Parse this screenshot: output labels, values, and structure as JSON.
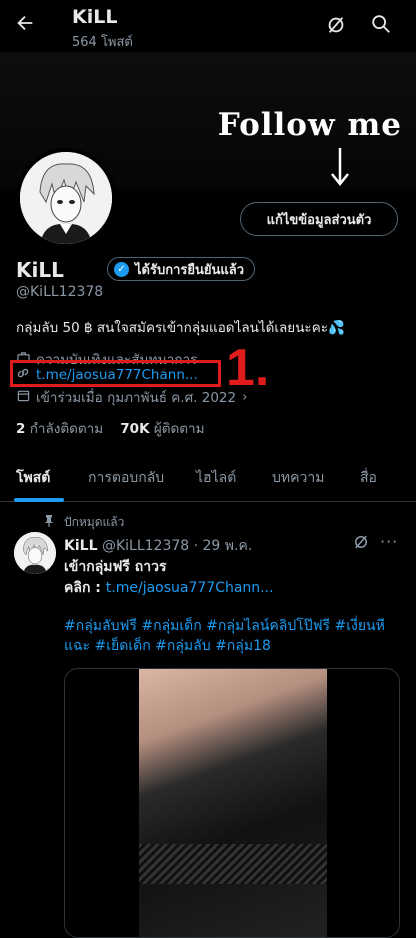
{
  "header": {
    "back_icon": "arrow-left-icon",
    "title": "KiLL",
    "post_count": "564 โพสต์",
    "grok_icon": "grok-icon",
    "search_icon": "search-icon"
  },
  "banner": {
    "text": "Follow me",
    "arrow_icon": "arrow-down-icon"
  },
  "profile": {
    "edit_button": "แก้ไขข้อมูลส่วนตัว",
    "name": "KiLL",
    "verified_label": "ได้รับการยืนยันแล้ว",
    "handle": "@KiLL12378",
    "bio": "กลุ่มลับ 50 ฿  สนใจสมัครเข้ากลุ่มแอดไลนได้เลยนะคะ💦",
    "category": "ความบันเทิงและสันทนาการ",
    "link": "t.me/jaosua777Chann...",
    "joined": "เข้าร่วมเมื่อ กุมภาพันธ์ ค.ศ. 2022",
    "following_count": "2",
    "following_label": "กำลังติดตาม",
    "followers_count": "70K",
    "followers_label": "ผู้ติดตาม"
  },
  "annotation": {
    "label": "1.",
    "color": "#e01b1b"
  },
  "tabs": [
    {
      "label": "โพสต์"
    },
    {
      "label": "การตอบกลับ"
    },
    {
      "label": "ไฮไลต์"
    },
    {
      "label": "บทความ"
    },
    {
      "label": "สื่อ"
    }
  ],
  "post": {
    "pinned_label": "ปักหมุดแล้ว",
    "author": "KiLL",
    "handle_date": "@KiLL12378 · 29 พ.ค.",
    "line1": "เข้ากลุ่มฟรี ถาวร",
    "line2_prefix": "คลิก : ",
    "line2_link": "t.me/jaosua777Chann...",
    "tags": "#กลุ่มลับฟรี #กลุ่มเด็ก #กลุ่มไลน์คลิปโป๊ฟรี #เงี่ยนหีแฉะ #เย็ดเด็ก #กลุ่มลับ #กลุ่ม18",
    "more_icon": "more-icon"
  },
  "colors": {
    "background": "#000000",
    "accent": "#1d9bf0",
    "text": "#e7e9ea",
    "muted": "#8b98a5",
    "annotation": "#e01b1b"
  }
}
